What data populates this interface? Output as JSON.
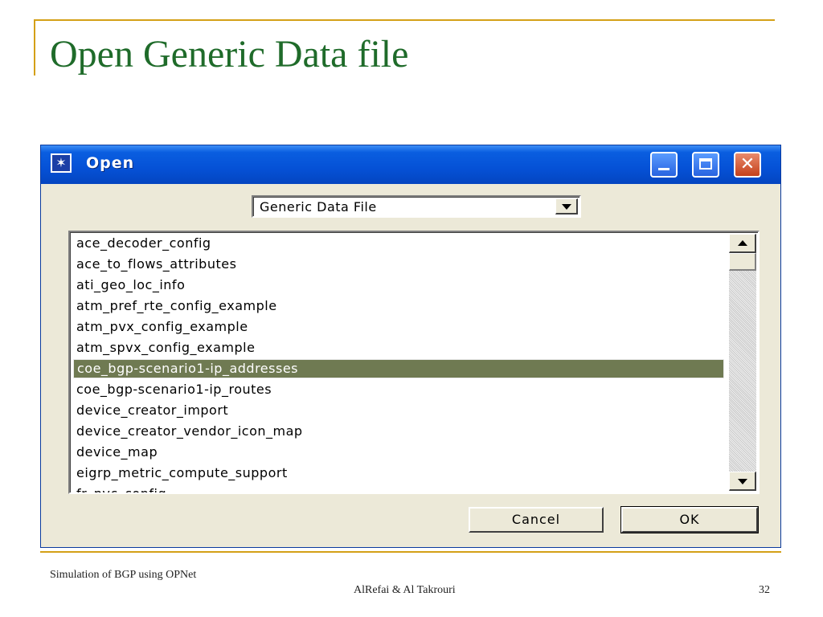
{
  "slide": {
    "title": "Open Generic Data file",
    "footer_left": "Simulation of  BGP using OPNet",
    "footer_center": "AlRefai & Al Takrouri",
    "page_number": "32",
    "accent_color": "#d4a017",
    "title_color": "#1f6b2a"
  },
  "dialog": {
    "title": "Open",
    "title_icon": "opnet-star-icon",
    "window_buttons": [
      "minimize",
      "maximize",
      "close"
    ],
    "file_type": {
      "selected": "Generic Data File"
    },
    "files": [
      "ace_decoder_config",
      "ace_to_flows_attributes",
      "ati_geo_loc_info",
      "atm_pref_rte_config_example",
      "atm_pvx_config_example",
      "atm_spvx_config_example",
      "coe_bgp-scenario1-ip_addresses",
      "coe_bgp-scenario1-ip_routes",
      "device_creator_import",
      "device_creator_vendor_icon_map",
      "device_map",
      "eigrp_metric_compute_support",
      "fr_pvc_config"
    ],
    "selected_file": "coe_bgp-scenario1-ip_addresses",
    "selection_color": "#6f7a52",
    "buttons": {
      "cancel": "Cancel",
      "ok": "OK"
    }
  }
}
